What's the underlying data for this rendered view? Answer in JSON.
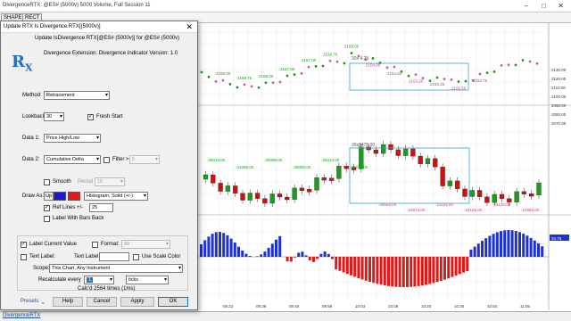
{
  "window": {
    "title": "DivergenceRTX: @ES# (5000v) 5000 Volume, Full Session 11"
  },
  "toolbar": {
    "shape_label": "SHAPE",
    "rect_label": "RECT"
  },
  "chart": {
    "price_labels": [
      "2130.00",
      "2120.00",
      "2110.00",
      "2100.00",
      "2090.00",
      "2080.00",
      "2070.00"
    ],
    "annotations_top": [
      "2158.00",
      "2158.75",
      "2158.00",
      "2157.00",
      "2157.00",
      "2158.75",
      "2158.00",
      "2154.00",
      "2154.00",
      "2153.25",
      "2155.25",
      "2155.50",
      "2154.75"
    ],
    "box_top_label": "30x 4.25",
    "box_mid_label": "30x8475.00",
    "annotations_mid": [
      "-29410.00",
      "-31058.00",
      "-30098.00",
      "-26000.00",
      "-26313.00",
      "-28229.00",
      "-34562.00",
      "-34973.00",
      "-31154.00",
      "-34155.00",
      "-24120.00",
      "-24953.00"
    ],
    "time_labels": [
      "09:22",
      "09:39",
      "09:40",
      "09:59",
      "10:03",
      "10:09",
      "10:20",
      "10:30",
      "10:54",
      "11:05"
    ],
    "delta_up_label": "34.75",
    "colors": {
      "up": "#1d9b1d",
      "down": "#d01010",
      "hist_up": "#1e32d2",
      "hist_down": "#e01818",
      "box": "#3aa0c8"
    }
  },
  "dialog": {
    "title": "Update RTX Is Divergence RTX[(5000v)]",
    "subtitle": "Update IsDivergence RTX[@ES# (5000v)] for @ES# (5000v)",
    "logo": "RX",
    "extension_text": "Divergence Extension: Divergence Indicator Version: 1.0",
    "method_label": "Method:",
    "method_value": "Retracement",
    "lookback_label": "Lookback",
    "lookback_value": "30",
    "fresh_start_label": "Fresh Start",
    "data1_label": "Data 1:",
    "data1_value": "Price High/Low",
    "data2_label": "Data 2:",
    "data2_value": "Cumulative Delta",
    "filter_label": "Filter >",
    "filter_value": "5",
    "smooth_label": "Smooth",
    "period_label": "Period",
    "period_value": "10",
    "draw_as_label": "Draw As:",
    "draw_up_label": "Up",
    "draw_style_value": "Histogram, Solid (+/-)",
    "ref_lines_label": "Ref Lines +/-",
    "ref_lines_value": "25",
    "label_bars_back": "Label With Bars Back",
    "label_current_value": "Label Current Value",
    "format_label": "Format:",
    "format_value": "99",
    "text_label": "Text Label:",
    "text_label2": "Text Label:",
    "use_scale_color": "Use Scale Color",
    "scope_label": "Scope:",
    "scope_value": "This Chart, Any Instrument",
    "recalc_label": "Recalculate every",
    "recalc_value": "1",
    "recalc_unit": "ticks",
    "calc_text": "Calc'd 2564 times (1ms)",
    "buttons": {
      "presets": "Presets",
      "help": "Help",
      "cancel": "Cancel",
      "apply": "Apply",
      "ok": "OK"
    }
  },
  "bottom_tab": {
    "label": "DivergenceRTX"
  }
}
